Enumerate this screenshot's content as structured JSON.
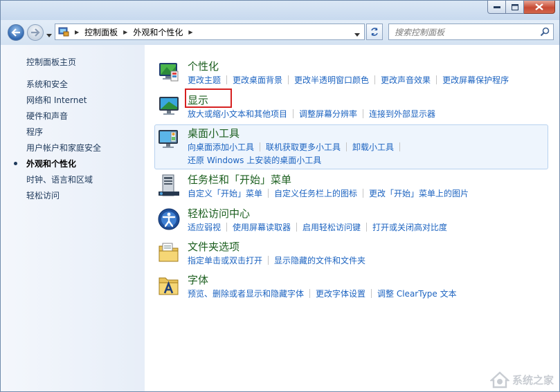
{
  "titlebar": {},
  "nav": {
    "breadcrumbs": [
      "控制面板",
      "外观和个性化"
    ],
    "search_placeholder": "搜索控制面板"
  },
  "sidebar": {
    "home": "控制面板主页",
    "items": [
      {
        "label": "系统和安全"
      },
      {
        "label": "网络和 Internet"
      },
      {
        "label": "硬件和声音"
      },
      {
        "label": "程序"
      },
      {
        "label": "用户帐户和家庭安全"
      },
      {
        "label": "外观和个性化",
        "active": true
      },
      {
        "label": "时钟、语言和区域"
      },
      {
        "label": "轻松访问"
      }
    ]
  },
  "categories": [
    {
      "title": "个性化",
      "links": [
        "更改主题",
        "更改桌面背景",
        "更改半透明窗口颜色",
        "更改声音效果",
        "更改屏幕保护程序"
      ],
      "icon": "personalization-icon"
    },
    {
      "title": "显示",
      "links": [
        "放大或缩小文本和其他项目",
        "调整屏幕分辨率",
        "连接到外部显示器"
      ],
      "icon": "display-icon",
      "highlighted_box": true
    },
    {
      "title": "桌面小工具",
      "links": [
        "向桌面添加小工具",
        "联机获取更多小工具",
        "卸载小工具"
      ],
      "links2": [
        "还原 Windows 上安装的桌面小工具"
      ],
      "icon": "gadgets-icon"
    },
    {
      "title": "任务栏和「开始」菜单",
      "links": [
        "自定义「开始」菜单",
        "自定义任务栏上的图标",
        "更改「开始」菜单上的图片"
      ],
      "icon": "taskbar-icon"
    },
    {
      "title": "轻松访问中心",
      "links": [
        "适应弱视",
        "使用屏幕读取器",
        "启用轻松访问键",
        "打开或关闭高对比度"
      ],
      "icon": "ease-of-access-icon"
    },
    {
      "title": "文件夹选项",
      "links": [
        "指定单击或双击打开",
        "显示隐藏的文件和文件夹"
      ],
      "icon": "folder-options-icon"
    },
    {
      "title": "字体",
      "links": [
        "预览、删除或者显示和隐藏字体",
        "更改字体设置",
        "调整 ClearType 文本"
      ],
      "icon": "fonts-icon"
    }
  ],
  "watermark": {
    "text": "系统之家"
  },
  "colors": {
    "link": "#1c63c0",
    "category_title": "#1c5f1f",
    "highlight_border": "#d62020"
  }
}
